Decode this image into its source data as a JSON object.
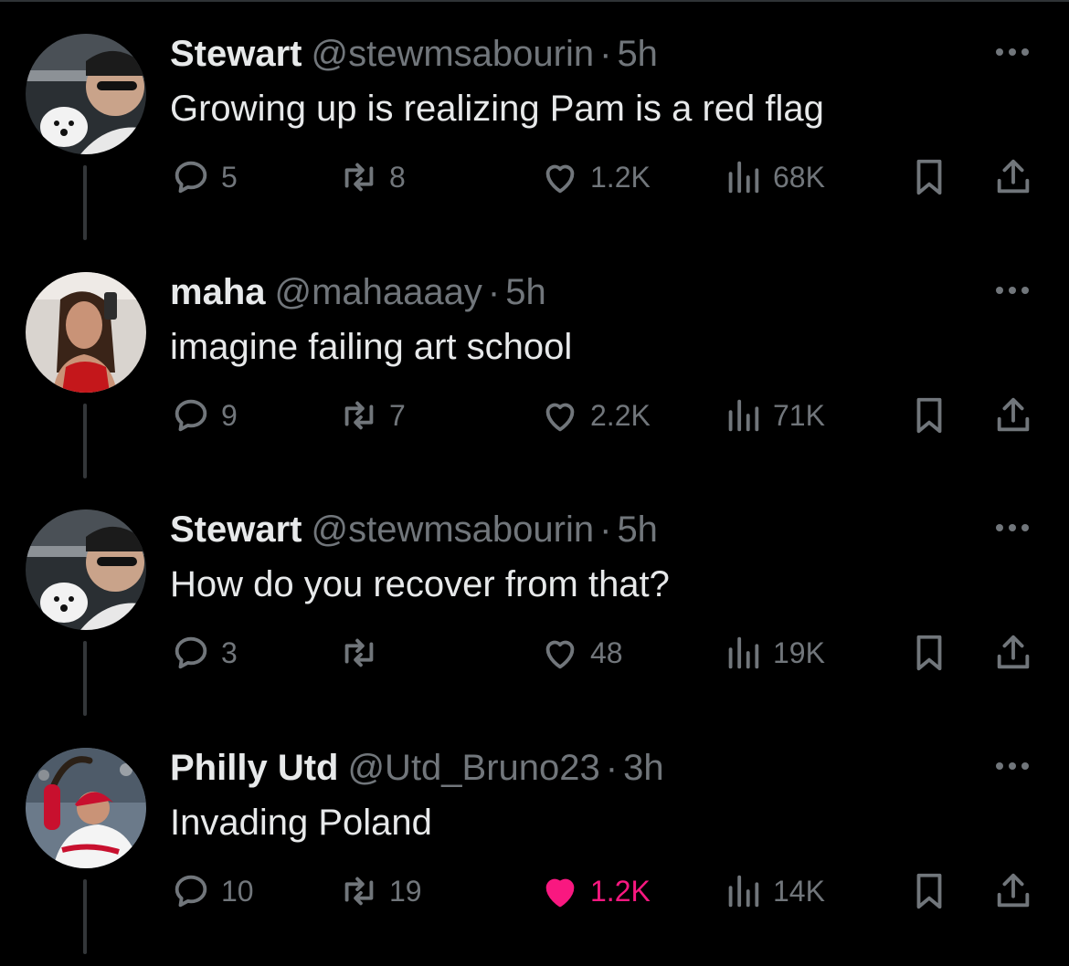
{
  "tweets": [
    {
      "name": "Stewart",
      "handle": "@stewmsabourin",
      "dot": "·",
      "time": "5h",
      "text": "Growing up is realizing Pam is a red flag",
      "replies": "5",
      "retweets": "8",
      "likes": "1.2K",
      "views": "68K",
      "liked": false
    },
    {
      "name": "maha",
      "handle": "@mahaaaay",
      "dot": "·",
      "time": "5h",
      "text": "imagine failing art school",
      "replies": "9",
      "retweets": "7",
      "likes": "2.2K",
      "views": "71K",
      "liked": false
    },
    {
      "name": "Stewart",
      "handle": "@stewmsabourin",
      "dot": "·",
      "time": "5h",
      "text": "How do you recover from that?",
      "replies": "3",
      "retweets": "",
      "likes": "48",
      "views": "19K",
      "liked": false
    },
    {
      "name": "Philly Utd",
      "handle": "@Utd_Bruno23",
      "dot": "·",
      "time": "3h",
      "text": "Invading Poland",
      "replies": "10",
      "retweets": "19",
      "likes": "1.2K",
      "views": "14K",
      "liked": true
    }
  ],
  "colors": {
    "background": "#000000",
    "text": "#e7e9ea",
    "muted": "#71767b",
    "like_active": "#f91880"
  },
  "icons": [
    "reply-icon",
    "retweet-icon",
    "like-icon",
    "views-icon",
    "bookmark-icon",
    "share-icon",
    "more-icon"
  ]
}
